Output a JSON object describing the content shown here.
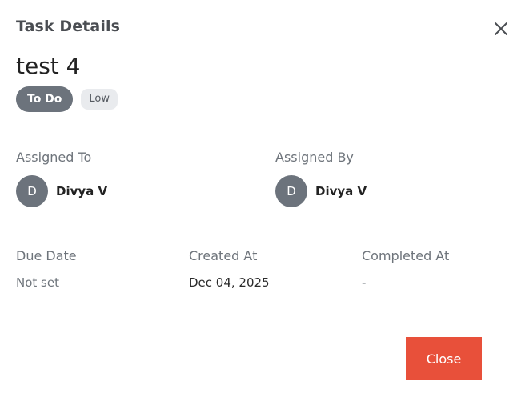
{
  "header": {
    "title": "Task Details",
    "close_icon": "close-icon"
  },
  "task": {
    "name": "test 4",
    "status": "To Do",
    "priority": "Low"
  },
  "assignment": {
    "assigned_to_label": "Assigned To",
    "assigned_to": {
      "initial": "D",
      "name": "Divya V"
    },
    "assigned_by_label": "Assigned By",
    "assigned_by": {
      "initial": "D",
      "name": "Divya V"
    }
  },
  "dates": {
    "due_label": "Due Date",
    "due_value": "Not set",
    "created_label": "Created At",
    "created_value": "Dec 04, 2025",
    "completed_label": "Completed At",
    "completed_value": "-"
  },
  "footer": {
    "close_label": "Close"
  },
  "colors": {
    "accent": "#e8503a",
    "badge_gray": "#6c737c",
    "chip_bg": "#e9ebee"
  }
}
